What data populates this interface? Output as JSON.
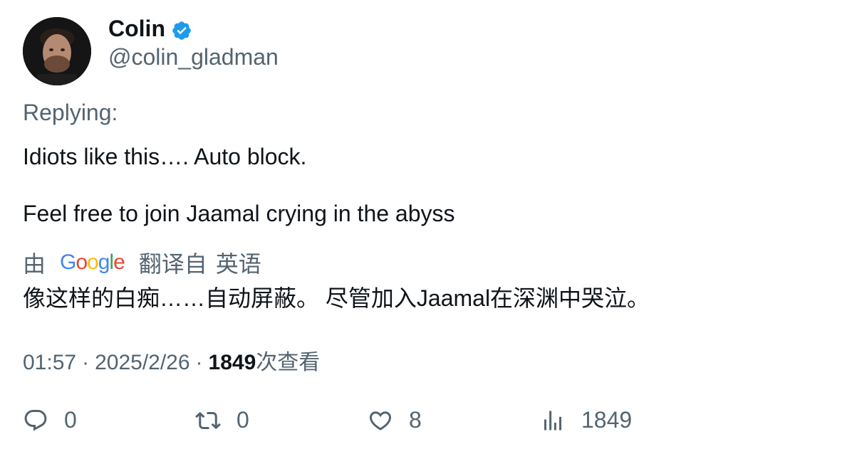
{
  "author": {
    "name": "Colin",
    "handle": "@colin_gladman",
    "verified": true
  },
  "tweet": {
    "replying_label": "Replying:",
    "lines": [
      "Idiots like this…. Auto block.",
      "Feel free to join Jaamal crying in the abyss"
    ],
    "translation": {
      "by": "由",
      "provider": "Google",
      "label_prefix": "翻译自",
      "source_language": "英语",
      "text": "像这样的白痴……自动屏蔽。 尽管加入Jaamal在深渊中哭泣。"
    },
    "timestamp_time": "01:57",
    "separator": "·",
    "timestamp_date": "2025/2/26",
    "views_count": "1849",
    "views_label": "次查看"
  },
  "actions": {
    "reply_count": "0",
    "retweet_count": "0",
    "like_count": "8",
    "views_count": "1849"
  },
  "colors": {
    "verified": "#1d9bf0",
    "secondary_text": "#536471",
    "primary_text": "#0f1419"
  }
}
